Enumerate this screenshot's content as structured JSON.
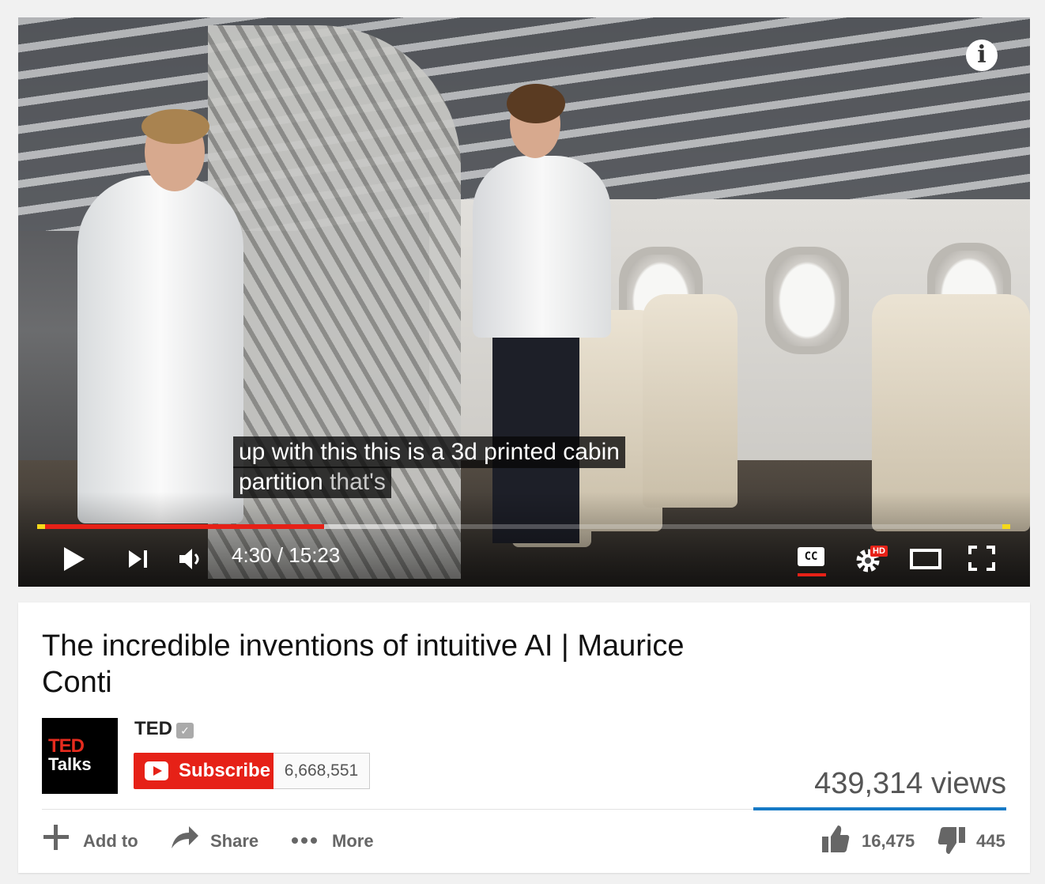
{
  "player": {
    "info_icon": "info-icon",
    "caption_line1": "up with this this is a 3d printed cabin",
    "caption_line2_main": "partition ",
    "caption_line2_dim": "that's",
    "time": "4:30 / 15:23",
    "progress_played": 0.295,
    "progress_buffered": 0.41,
    "cc_label": "CC",
    "hd_badge": "HD",
    "icons": [
      "play-icon",
      "next-icon",
      "volume-icon",
      "captions-icon",
      "settings-icon",
      "theater-mode-icon",
      "fullscreen-icon"
    ],
    "accent_color": "#e62117"
  },
  "video": {
    "title": "The incredible inventions of intuitive AI | Maurice Conti",
    "views": "439,314 views"
  },
  "channel": {
    "name": "TED",
    "avatar_line1": "TED",
    "avatar_line2": "Talks",
    "subscribe_label": "Subscribe",
    "subscriber_count": "6,668,551"
  },
  "actions": {
    "add_to": "Add to",
    "share": "Share",
    "more": "More",
    "likes": "16,475",
    "dislikes": "445"
  }
}
